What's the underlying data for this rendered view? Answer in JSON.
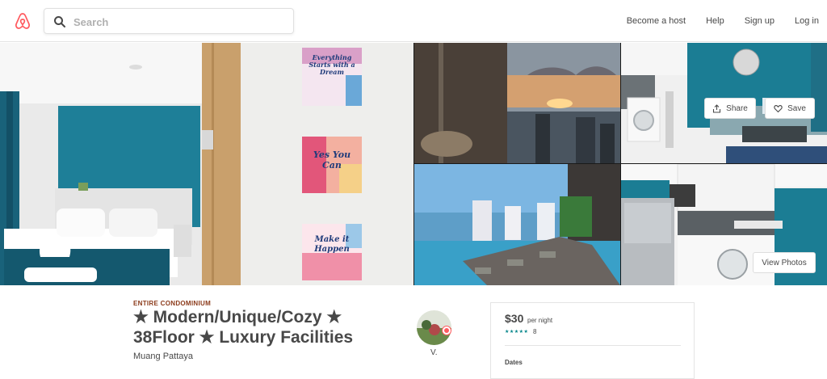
{
  "header": {
    "search_placeholder": "Search",
    "nav": [
      "Become a host",
      "Help",
      "Sign up",
      "Log in"
    ],
    "brand_color": "#FF5A5F"
  },
  "gallery": {
    "wall_art": [
      "Everything Starts with a Dream",
      "Yes You Can",
      "Make it Happen"
    ],
    "share_label": "Share",
    "save_label": "Save",
    "view_photos_label": "View Photos"
  },
  "listing": {
    "type_label": "ENTIRE CONDOMINIUM",
    "title_line1": "★ Modern/Unique/Cozy ★",
    "title_line2": "38Floor ★ Luxury Facilities",
    "location": "Muang Pattaya",
    "host_initial": "V."
  },
  "booking": {
    "price": "$30",
    "per_night": "per night",
    "stars": "★★★★★",
    "review_count": "8",
    "dates_label": "Dates"
  },
  "colors": {
    "title_text": "#484848",
    "eyebrow": "#8B3A1A",
    "rating": "#008489"
  }
}
